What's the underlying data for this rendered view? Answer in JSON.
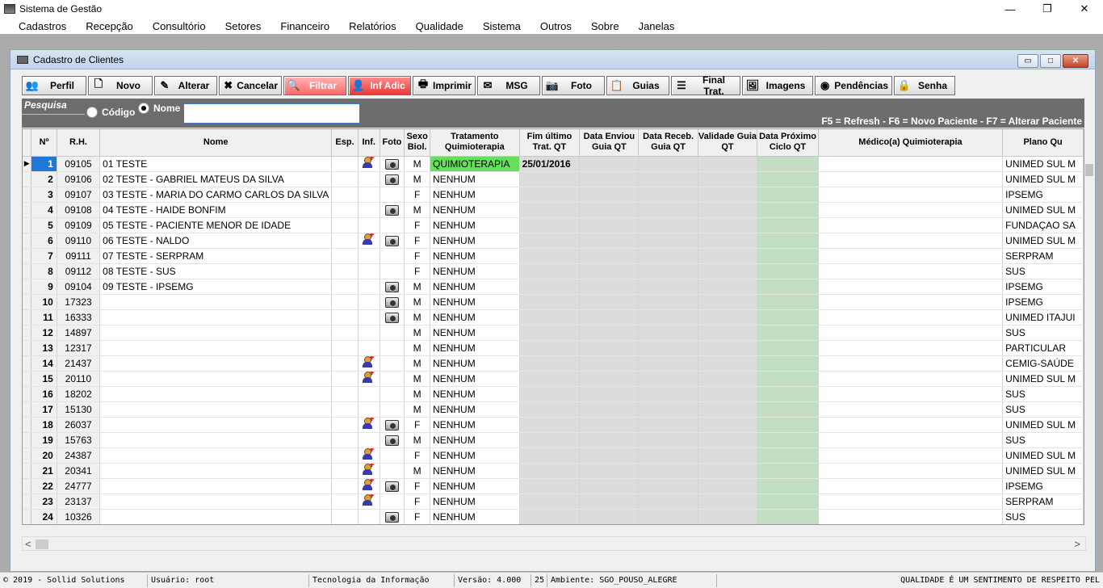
{
  "window": {
    "title": "Sistema de Gestão",
    "minimize": "—",
    "maximize": "❐",
    "close": "✕"
  },
  "menu": [
    "Cadastros",
    "Recepção",
    "Consultório",
    "Setores",
    "Financeiro",
    "Relatórios",
    "Qualidade",
    "Sistema",
    "Outros",
    "Sobre",
    "Janelas"
  ],
  "child": {
    "title": "Cadastro de Clientes",
    "min": "▭",
    "max": "□",
    "close": "✕"
  },
  "toolbar": [
    {
      "label": "Perfil",
      "icon": "users-icon",
      "glyph": "👥",
      "style": "",
      "w": 80
    },
    {
      "label": "Novo",
      "icon": "new-doc-icon",
      "glyph": "🗋",
      "style": "",
      "w": 80
    },
    {
      "label": "Alterar",
      "icon": "edit-icon",
      "glyph": "✎",
      "style": "",
      "w": 78
    },
    {
      "label": "Cancelar",
      "icon": "cancel-icon",
      "glyph": "✖",
      "style": "",
      "w": 78
    },
    {
      "label": "Filtrar",
      "icon": "search-icon",
      "glyph": "🔍",
      "style": "red",
      "w": 78
    },
    {
      "label": "Inf Adic",
      "icon": "user-add-icon",
      "glyph": "👤",
      "style": "red2",
      "w": 78
    },
    {
      "label": "Imprimir",
      "icon": "printer-icon",
      "glyph": "🖶",
      "style": "",
      "w": 78
    },
    {
      "label": "MSG",
      "icon": "mail-icon",
      "glyph": "✉",
      "style": "",
      "w": 78
    },
    {
      "label": "Foto",
      "icon": "camera-icon",
      "glyph": "📷",
      "style": "",
      "w": 78
    },
    {
      "label": "Guias",
      "icon": "guides-icon",
      "glyph": "📋",
      "style": "",
      "w": 78
    },
    {
      "label": "Final Trat.",
      "icon": "list-icon",
      "glyph": "☰",
      "style": "",
      "w": 86
    },
    {
      "label": "Imagens",
      "icon": "images-icon",
      "glyph": "🖼",
      "style": "",
      "w": 88
    },
    {
      "label": "Pendências",
      "icon": "pending-icon",
      "glyph": "◉",
      "style": "",
      "w": 96
    },
    {
      "label": "Senha",
      "icon": "lock-icon",
      "glyph": "🔒",
      "style": "",
      "w": 76
    }
  ],
  "search": {
    "label": "Pesquisa",
    "option_codigo": "Código",
    "option_nome": "Nome",
    "selected": "Nome",
    "value": "",
    "hint": "F5 = Refresh  -  F6 = Novo Paciente  -  F7 = Alterar Paciente"
  },
  "columns": [
    "Nº",
    "R.H.",
    "Nome",
    "Esp.",
    "Inf.",
    "Foto",
    "Sexo Biol.",
    "Tratamento Quimioterapia",
    "Fim último Trat. QT",
    "Data Enviou Guia QT",
    "Data Receb. Guia QT",
    "Validade Guia QT",
    "Data Próximo Ciclo QT",
    "Médico(a) Quimioterapia",
    "Plano Qu"
  ],
  "rows": [
    {
      "n": "1",
      "rh": "09105",
      "nome": "01 TESTE",
      "inf": true,
      "foto": true,
      "sexo": "M",
      "trat": "QUIMIOTERAPIA",
      "fim": "25/01/2016",
      "plano": "UNIMED SUL M"
    },
    {
      "n": "2",
      "rh": "09106",
      "nome": "02 TESTE - GABRIEL MATEUS DA SILVA",
      "inf": false,
      "foto": true,
      "sexo": "M",
      "trat": "NENHUM",
      "fim": "",
      "plano": "UNIMED SUL M"
    },
    {
      "n": "3",
      "rh": "09107",
      "nome": "03 TESTE - MARIA DO CARMO CARLOS DA SILVA",
      "inf": false,
      "foto": false,
      "sexo": "F",
      "trat": "NENHUM",
      "fim": "",
      "plano": "IPSEMG"
    },
    {
      "n": "4",
      "rh": "09108",
      "nome": "04 TESTE - HAIDE BONFIM",
      "inf": false,
      "foto": true,
      "sexo": "M",
      "trat": "NENHUM",
      "fim": "",
      "plano": "UNIMED SUL M"
    },
    {
      "n": "5",
      "rh": "09109",
      "nome": "05 TESTE - PACIENTE MENOR DE IDADE",
      "inf": false,
      "foto": false,
      "sexo": "F",
      "trat": "NENHUM",
      "fim": "",
      "plano": "FUNDAÇAO SA"
    },
    {
      "n": "6",
      "rh": "09110",
      "nome": "06 TESTE - NALDO",
      "inf": true,
      "foto": true,
      "sexo": "F",
      "trat": "NENHUM",
      "fim": "",
      "plano": "UNIMED SUL M"
    },
    {
      "n": "7",
      "rh": "09111",
      "nome": "07 TESTE - SERPRAM",
      "inf": false,
      "foto": false,
      "sexo": "F",
      "trat": "NENHUM",
      "fim": "",
      "plano": "SERPRAM"
    },
    {
      "n": "8",
      "rh": "09112",
      "nome": "08 TESTE - SUS",
      "inf": false,
      "foto": false,
      "sexo": "F",
      "trat": "NENHUM",
      "fim": "",
      "plano": "SUS"
    },
    {
      "n": "9",
      "rh": "09104",
      "nome": "09 TESTE - IPSEMG",
      "inf": false,
      "foto": true,
      "sexo": "M",
      "trat": "NENHUM",
      "fim": "",
      "plano": "IPSEMG"
    },
    {
      "n": "10",
      "rh": "17323",
      "nome": "",
      "inf": false,
      "foto": true,
      "sexo": "M",
      "trat": "NENHUM",
      "fim": "",
      "plano": "IPSEMG"
    },
    {
      "n": "11",
      "rh": "16333",
      "nome": "",
      "inf": false,
      "foto": true,
      "sexo": "M",
      "trat": "NENHUM",
      "fim": "",
      "plano": "UNIMED ITAJUI"
    },
    {
      "n": "12",
      "rh": "14897",
      "nome": "",
      "inf": false,
      "foto": false,
      "sexo": "M",
      "trat": "NENHUM",
      "fim": "",
      "plano": "SUS"
    },
    {
      "n": "13",
      "rh": "12317",
      "nome": "",
      "inf": false,
      "foto": false,
      "sexo": "M",
      "trat": "NENHUM",
      "fim": "",
      "plano": "PARTICULAR"
    },
    {
      "n": "14",
      "rh": "21437",
      "nome": "",
      "inf": true,
      "foto": false,
      "sexo": "M",
      "trat": "NENHUM",
      "fim": "",
      "plano": "CEMIG-SAÚDE"
    },
    {
      "n": "15",
      "rh": "20110",
      "nome": "",
      "inf": true,
      "foto": false,
      "sexo": "M",
      "trat": "NENHUM",
      "fim": "",
      "plano": "UNIMED SUL M"
    },
    {
      "n": "16",
      "rh": "18202",
      "nome": "",
      "inf": false,
      "foto": false,
      "sexo": "M",
      "trat": "NENHUM",
      "fim": "",
      "plano": "SUS"
    },
    {
      "n": "17",
      "rh": "15130",
      "nome": "",
      "inf": false,
      "foto": false,
      "sexo": "M",
      "trat": "NENHUM",
      "fim": "",
      "plano": "SUS"
    },
    {
      "n": "18",
      "rh": "26037",
      "nome": "",
      "inf": true,
      "foto": true,
      "sexo": "F",
      "trat": "NENHUM",
      "fim": "",
      "plano": "UNIMED SUL M"
    },
    {
      "n": "19",
      "rh": "15763",
      "nome": "",
      "inf": false,
      "foto": true,
      "sexo": "M",
      "trat": "NENHUM",
      "fim": "",
      "plano": "SUS"
    },
    {
      "n": "20",
      "rh": "24387",
      "nome": "",
      "inf": true,
      "foto": false,
      "sexo": "F",
      "trat": "NENHUM",
      "fim": "",
      "plano": "UNIMED SUL M"
    },
    {
      "n": "21",
      "rh": "20341",
      "nome": "",
      "inf": true,
      "foto": false,
      "sexo": "M",
      "trat": "NENHUM",
      "fim": "",
      "plano": "UNIMED SUL M"
    },
    {
      "n": "22",
      "rh": "24777",
      "nome": "",
      "inf": true,
      "foto": true,
      "sexo": "F",
      "trat": "NENHUM",
      "fim": "",
      "plano": "IPSEMG"
    },
    {
      "n": "23",
      "rh": "23137",
      "nome": "",
      "inf": true,
      "foto": false,
      "sexo": "F",
      "trat": "NENHUM",
      "fim": "",
      "plano": "SERPRAM"
    },
    {
      "n": "24",
      "rh": "10326",
      "nome": "",
      "inf": false,
      "foto": true,
      "sexo": "F",
      "trat": "NENHUM",
      "fim": "",
      "plano": "SUS"
    }
  ],
  "selected_row": "1",
  "scroll": {
    "left": "<",
    "right": ">"
  },
  "status": [
    "© 2019 - Sollid Solutions",
    "Usuário: root",
    "Tecnologia da Informação",
    "Versão: 4.000",
    "25",
    "Ambiente: SGO_POUSO_ALEGRE",
    "QUALIDADE É UM SENTIMENTO DE RESPEITO PEL"
  ]
}
